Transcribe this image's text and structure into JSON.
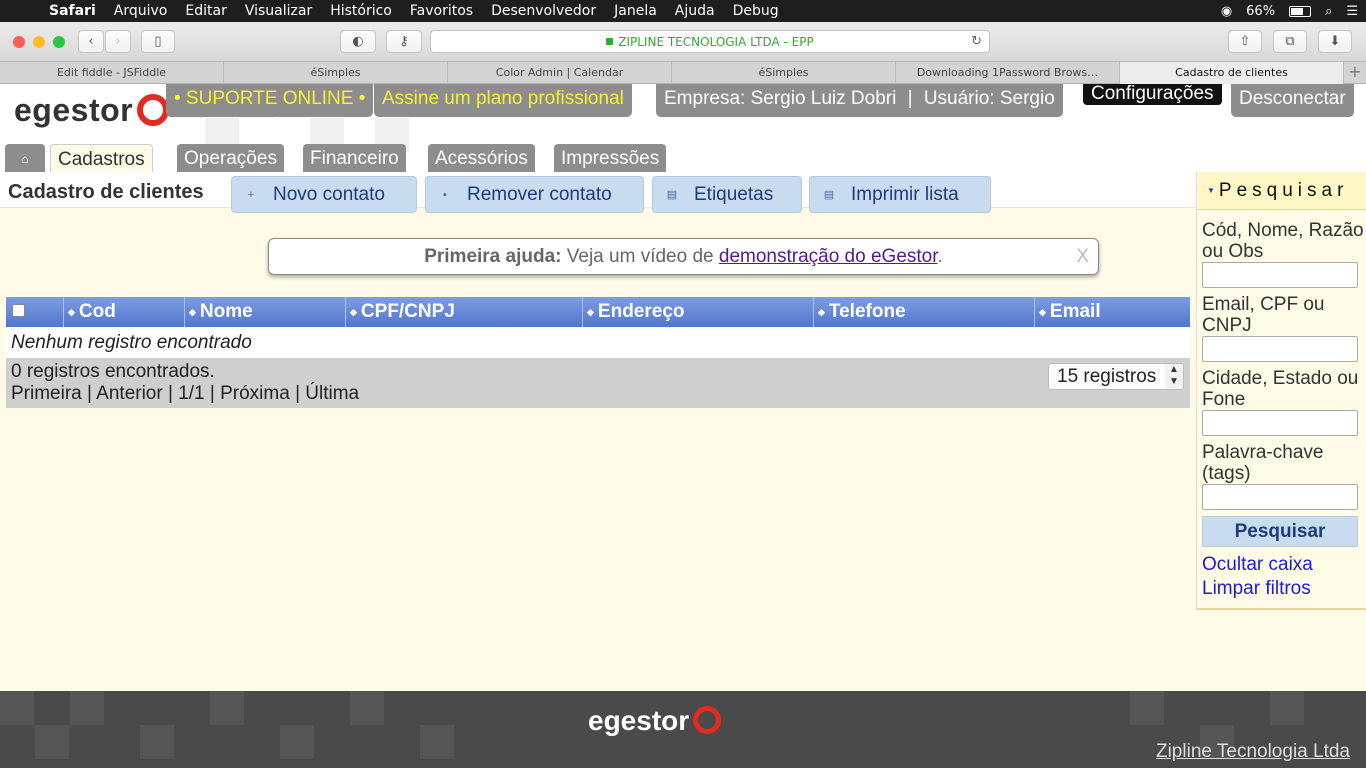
{
  "menubar": {
    "app": "Safari",
    "items": [
      "Arquivo",
      "Editar",
      "Visualizar",
      "Histórico",
      "Favoritos",
      "Desenvolvedor",
      "Janela",
      "Ajuda",
      "Debug"
    ],
    "battery": "66%",
    "battery_level": 0.66
  },
  "browser": {
    "address": "ZIPLINE TECNOLOGIA LTDA - EPP",
    "tabs": [
      "Edit fiddle - JSFiddle",
      "éSimples",
      "Color Admin | Calendar",
      "éSimples",
      "Downloading 1Password Brows…",
      "Cadastro de clientes"
    ]
  },
  "header": {
    "suporte": "• SUPORTE ONLINE •",
    "assine": "Assine um plano profissional",
    "empresa": "Empresa: Sergio Luiz Dobri",
    "separator": "|",
    "usuario": "Usuário: Sergio",
    "configuracoes": "Configurações",
    "desconectar": "Desconectar",
    "logo_text": "egestor"
  },
  "main_tabs": [
    "Cadastros",
    "Operações",
    "Financeiro",
    "Acessórios",
    "Impressões"
  ],
  "toolbar": {
    "title": "Cadastro de clientes",
    "actions": [
      "Novo contato",
      "Remover contato",
      "Etiquetas",
      "Imprimir lista"
    ]
  },
  "help": {
    "label": "Primeira ajuda:",
    "text": "Veja um vídeo de",
    "link": "demonstração do eGestor",
    "end": ".",
    "close": "X"
  },
  "grid": {
    "columns": [
      "Cod",
      "Nome",
      "CPF/CNPJ",
      "Endereço",
      "Telefone",
      "Email"
    ],
    "empty": "Nenhum registro encontrado",
    "count": "0 registros encontrados.",
    "pager": "Primeira | Anterior | 1/1 | Próxima | Última",
    "page_size": "15 registros"
  },
  "search": {
    "title": "Pesquisar",
    "fields": [
      "Cód, Nome, Razão ou Obs",
      "Email, CPF ou CNPJ",
      "Cidade, Estado ou Fone",
      "Palavra-chave (tags)"
    ],
    "button": "Pesquisar",
    "hide": "Ocultar caixa",
    "clear": "Limpar filtros"
  },
  "footer": {
    "logo_text": "egestor",
    "company": "Zipline Tecnologia Ltda"
  }
}
